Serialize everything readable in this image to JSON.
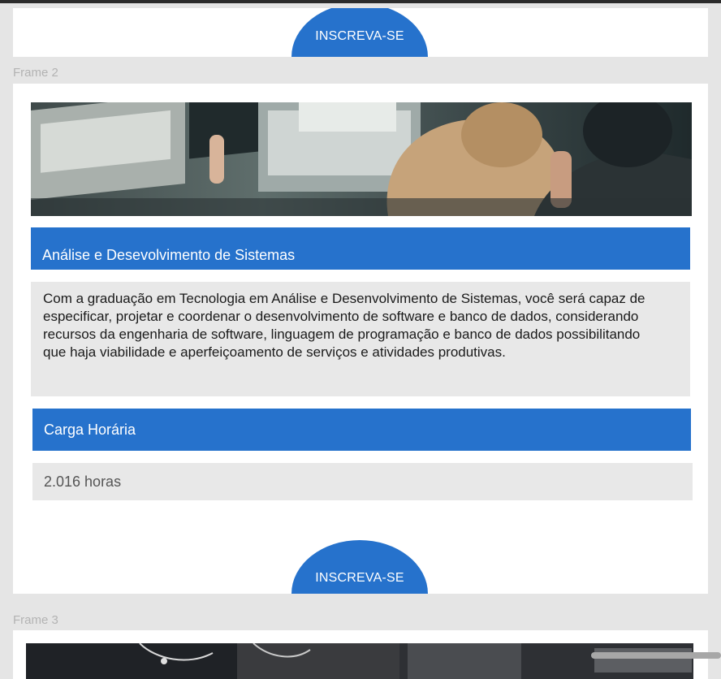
{
  "frames": [
    {
      "label": "Frame 2"
    },
    {
      "label": "Frame 3"
    }
  ],
  "cta": {
    "label": "INSCREVA-SE"
  },
  "course": {
    "title": "Análise e Desevolvimento de Sistemas",
    "description": "Com a graduação em Tecnologia em Análise e Desenvolvimento de Sistemas, você será capaz de especificar, projetar e coordenar o desenvolvimento de software e banco de dados, considerando recursos da engenharia de software, linguagem de programação e banco de dados possibilitando que haja viabilidade e aperfeiçoamento de serviços e atividades produtivas.",
    "workload_heading": "Carga Horária",
    "workload_value": "2.016 horas"
  },
  "colors": {
    "accent": "#2672cc",
    "panel": "#e8e8e8",
    "canvas": "#e5e5e5",
    "frame_label": "#b3b3b3"
  },
  "icons": [
    "course-photo-image",
    "banner-image"
  ]
}
